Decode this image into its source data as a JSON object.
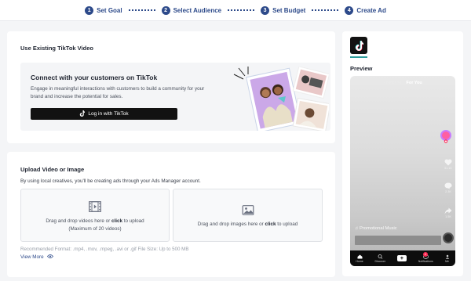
{
  "stepper": {
    "steps": [
      {
        "num": "1",
        "label": "Set Goal"
      },
      {
        "num": "2",
        "label": "Select Audience"
      },
      {
        "num": "3",
        "label": "Set Budget"
      },
      {
        "num": "4",
        "label": "Create Ad"
      }
    ]
  },
  "existing_video": {
    "title": "Use Existing TikTok Video",
    "connect_heading": "Connect with your customers on TikTok",
    "connect_text": "Engage in meaningful interactions with customers to build a community for your brand and increase the potential for sales.",
    "login_label": "Log in with TikTok"
  },
  "upload": {
    "title": "Upload Video or Image",
    "subtitle": "By using local creatives, you'll be creating ads through your Ads Manager account.",
    "video_drop_prefix": "Drag and drop videos here or ",
    "video_drop_link": "click",
    "video_drop_suffix": " to upload",
    "video_drop_note": "(Maximum of 20 videos)",
    "image_drop_prefix": "Drag and drop images here or ",
    "image_drop_link": "click",
    "image_drop_suffix": " to upload",
    "recommended": "Recommended Format: .mp4, .mov, .mpeg, .avi or .gif File Size: Up to 500 MB",
    "view_more": "View More"
  },
  "preview": {
    "label": "Preview",
    "following": "Following",
    "for_you": "For You",
    "side_counts": [
      "31.1K",
      "2.3K",
      "1.5K"
    ],
    "music": "Promotional Music",
    "nav": [
      "Home",
      "Discover",
      "",
      "Notifications",
      "Me"
    ],
    "notification_badge": "4"
  },
  "colors": {
    "accent": "#2d4a8a",
    "tiktok_black": "#121212",
    "card_bg": "#ffffff",
    "page_bg": "#f4f5f7"
  },
  "icons": {
    "login": "tiktok-note-icon",
    "video_drop": "film-icon",
    "image_drop": "image-icon",
    "view_more": "eye-icon"
  }
}
